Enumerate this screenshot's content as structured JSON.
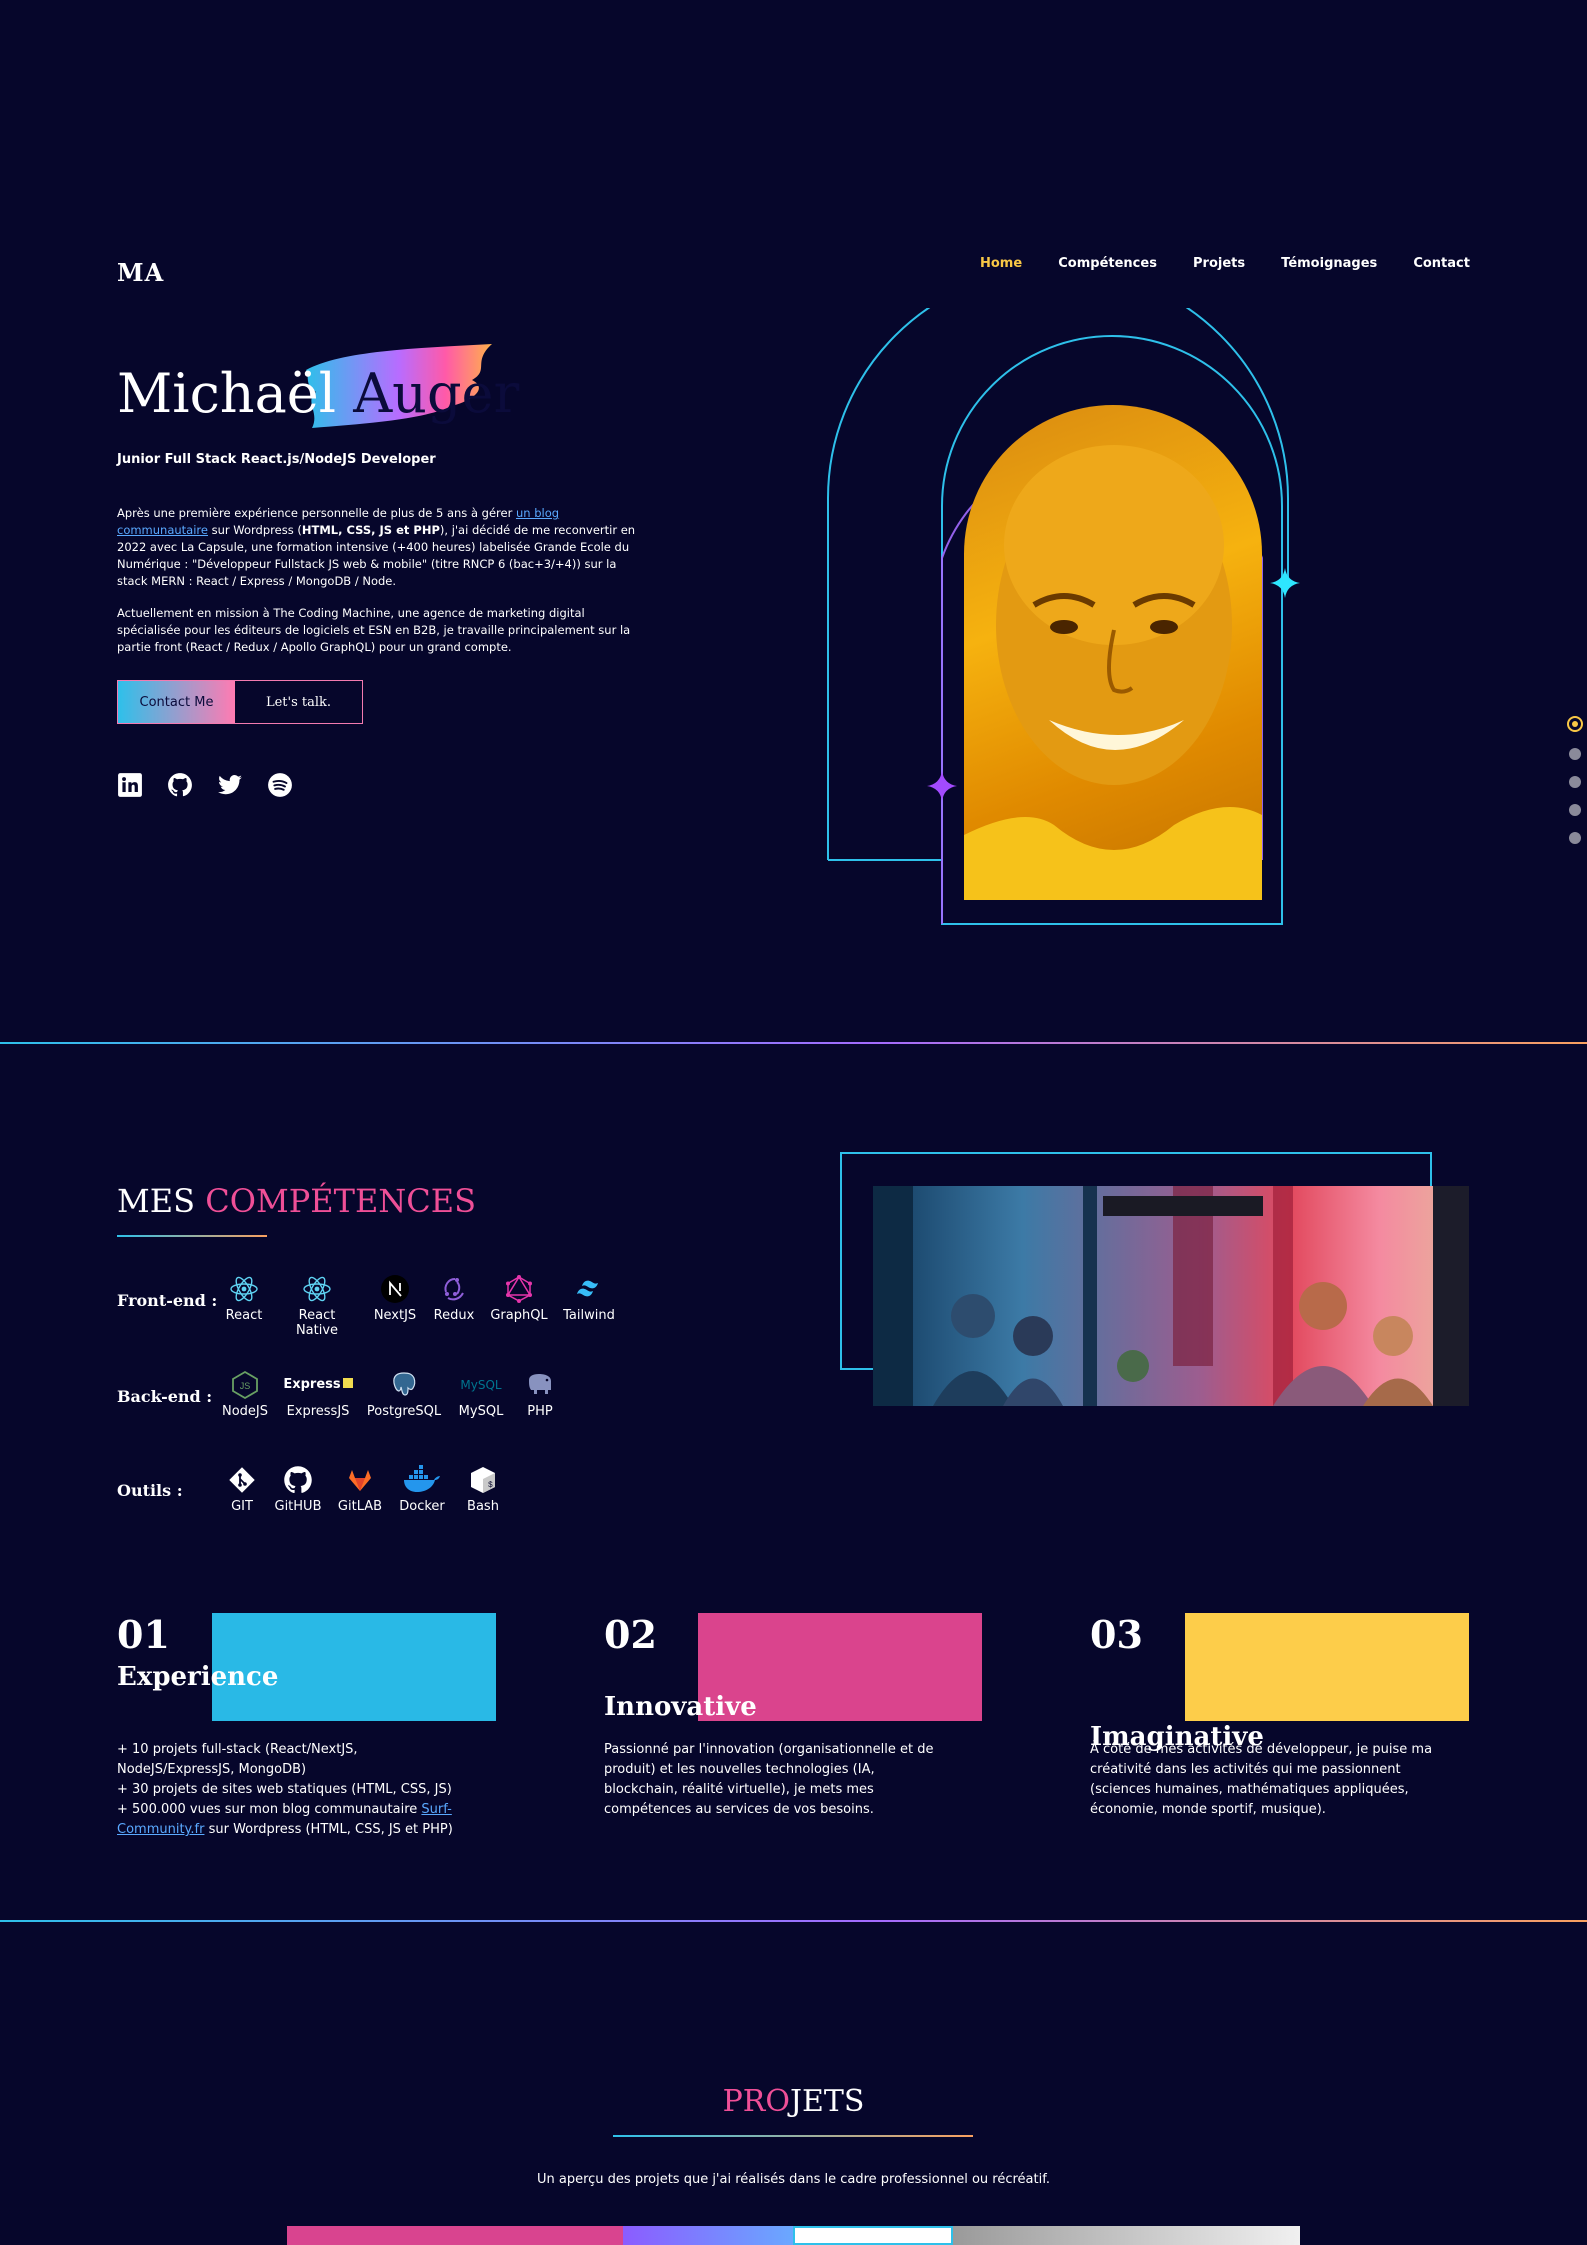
{
  "nav": {
    "logo": "MA",
    "items": [
      "Home",
      "Compétences",
      "Projets",
      "Témoignages",
      "Contact"
    ],
    "active": "Home"
  },
  "hero": {
    "first_name": "Michaël",
    "last_name": "Auger",
    "subtitle": "Junior Full Stack React.js/NodeJS Developer",
    "p1_a": "Après une première expérience personnelle de plus de 5 ans à gérer ",
    "p1_link": "un blog communautaire",
    "p1_b": " sur Wordpress (",
    "p1_bold": "HTML, CSS, JS et PHP",
    "p1_c": "), j'ai décidé de me reconvertir en 2022 avec La Capsule, une formation intensive (+400 heures) labelisée Grande Ecole du Numérique : \"Développeur Fullstack JS web & mobile\" (titre RNCP 6 (bac+3/+4)) sur la stack MERN : React / Express / MongoDB / Node.",
    "p2": "Actuellement en mission à The Coding Machine, une agence de marketing digital spécialisée pour les éditeurs de logiciels et ESN en B2B, je travaille principalement sur la partie front (React / Redux / Apollo GraphQL) pour un grand compte.",
    "cta_primary": "Contact Me",
    "cta_secondary": "Let's talk.",
    "social": [
      "linkedin-icon",
      "github-icon",
      "twitter-icon",
      "spotify-icon"
    ]
  },
  "skills": {
    "title_a": "MES ",
    "title_b": "COMPÉTENCES",
    "frontend_label": "Front-end :",
    "frontend": [
      "React",
      "React Native",
      "NextJS",
      "Redux",
      "GraphQL",
      "Tailwind"
    ],
    "backend_label": "Back-end :",
    "backend": [
      "NodeJS",
      "ExpressJS",
      "PostgreSQL",
      "MySQL",
      "PHP"
    ],
    "tools_label": "Outils :",
    "tools": [
      "GIT",
      "GitHUB",
      "GitLAB",
      "Docker",
      "Bash"
    ],
    "logo_express": "Express",
    "logo_mysql": "MySQL"
  },
  "features": [
    {
      "num": "01",
      "title": "Experience",
      "color": "#29b9e6",
      "lines_a": "+ 10 projets full-stack (React/NextJS, NodeJS/ExpressJS, MongoDB)",
      "lines_b": "+ 30 projets de sites web statiques (HTML, CSS, JS)",
      "lines_c": "+ 500.000 vues sur mon blog communautaire ",
      "link": "Surf-Community.fr",
      "lines_d": " sur Wordpress (HTML, CSS, JS et PHP)"
    },
    {
      "num": "02",
      "title": "Innovative",
      "color": "#da448d",
      "text": "Passionné par l'innovation (organisationnelle et de produit) et les nouvelles technologies (IA, blockchain, réalité virtuelle), je mets mes compétences au services de vos besoins."
    },
    {
      "num": "03",
      "title": "Imaginative",
      "color": "#fdcd4a",
      "text": "À côté de mes activités de développeur, je puise ma créativité dans les activités qui me passionnent (sciences humaines, mathématiques appliquées, économie, monde sportif, musique)."
    }
  ],
  "projects": {
    "title_a": "PRO",
    "title_b": "JETS",
    "subtitle": "Un aperçu des projets que j'ai réalisés dans le cadre professionnel ou récréatif."
  },
  "colors": {
    "background": "#06062b",
    "accent_yellow": "#f9c846",
    "accent_cyan": "#2ec0ea",
    "accent_pink": "#ef4f97",
    "accent_purple": "#a36bff"
  }
}
